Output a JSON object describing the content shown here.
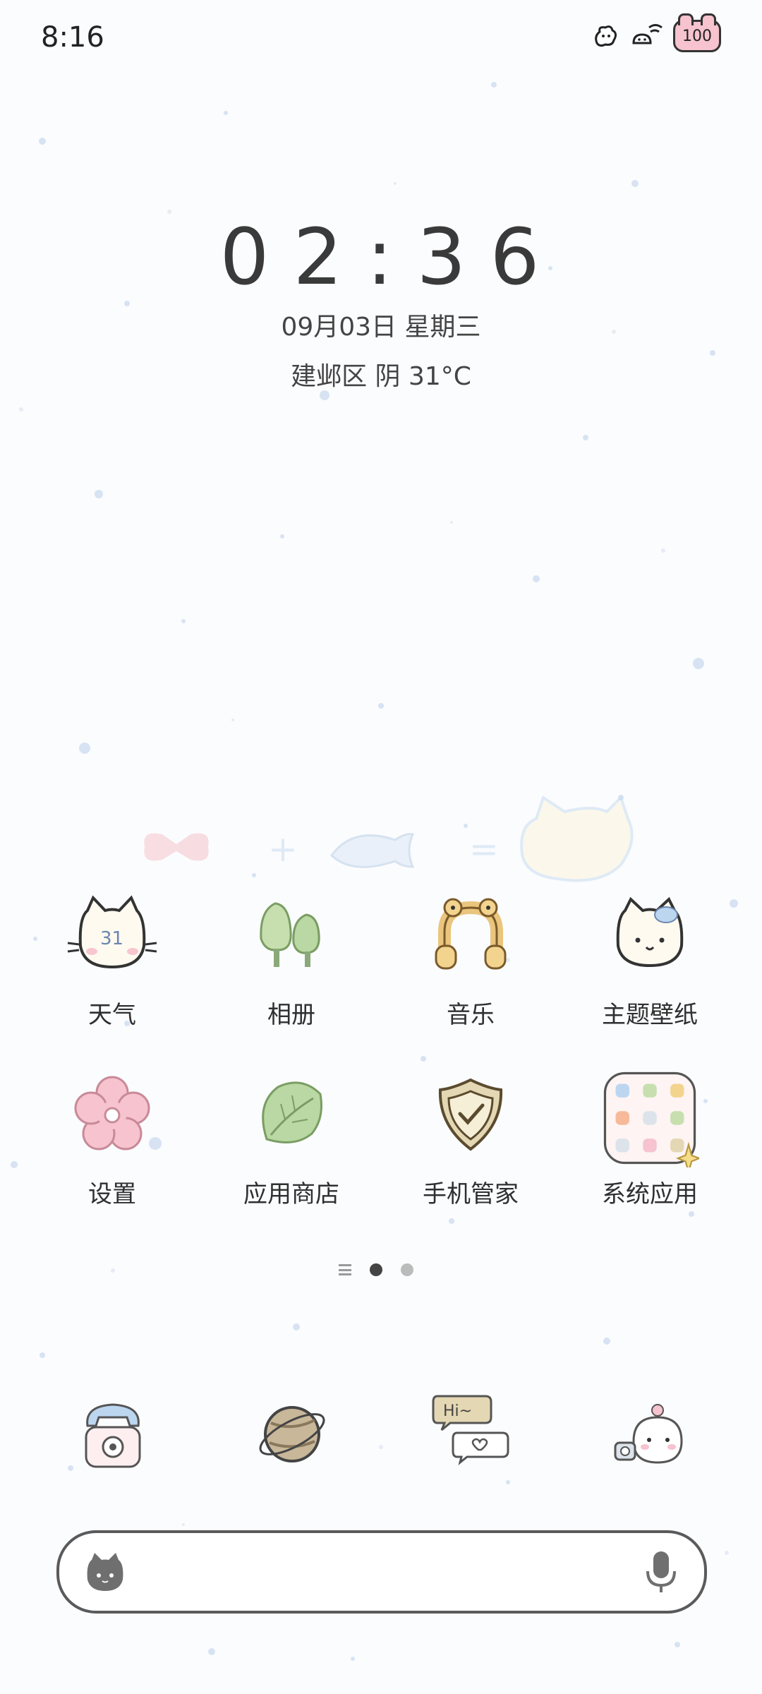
{
  "status_bar": {
    "time": "8:16",
    "battery": "100"
  },
  "clock_widget": {
    "time": "02:36",
    "date": "09月03日 星期三",
    "weather": "建邺区 阴 31°C"
  },
  "apps": [
    {
      "label": "天气",
      "icon": "cat-weather-icon",
      "badge": "31"
    },
    {
      "label": "相册",
      "icon": "trees-gallery-icon"
    },
    {
      "label": "音乐",
      "icon": "headphones-frog-icon"
    },
    {
      "label": "主题壁纸",
      "icon": "cat-theme-icon"
    },
    {
      "label": "设置",
      "icon": "flower-settings-icon"
    },
    {
      "label": "应用商店",
      "icon": "leaf-store-icon"
    },
    {
      "label": "手机管家",
      "icon": "shield-manager-icon"
    },
    {
      "label": "系统应用",
      "icon": "folder-system-apps-icon"
    }
  ],
  "page_indicator": {
    "pages": 2,
    "active": 0
  },
  "dock": [
    {
      "icon": "telephone-icon"
    },
    {
      "icon": "planet-browser-icon"
    },
    {
      "icon": "chat-bubbles-icon",
      "text": "Hi~"
    },
    {
      "icon": "bunny-camera-icon"
    }
  ],
  "search_bar": {
    "placeholder": ""
  },
  "colors": {
    "background": "#fbfcfe",
    "accent_blue": "#c9dcf0",
    "pink": "#f6c3cf",
    "green": "#b9d8a4"
  }
}
